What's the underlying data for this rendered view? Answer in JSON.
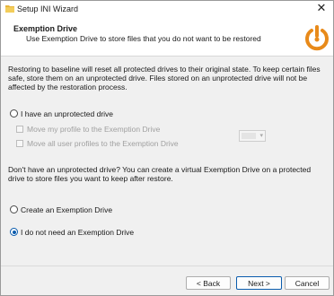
{
  "window": {
    "title": "Setup INI Wizard"
  },
  "header": {
    "title": "Exemption Drive",
    "subtitle": "Use Exemption Drive to store files that you do not want to be restored"
  },
  "intro_text": "Restoring to baseline will reset all protected drives to their original state. To keep certain files safe, store them on an unprotected drive. Files stored on an unprotected drive will not be affected by the restoration process.",
  "options": {
    "have_unprotected": {
      "label": "I have an unprotected drive",
      "selected": false
    },
    "move_my_profile": {
      "label": "Move my profile to the Exemption Drive",
      "checked": false,
      "enabled": false
    },
    "move_all_profiles": {
      "label": "Move all user profiles to the Exemption Drive",
      "checked": false,
      "enabled": false
    },
    "drive_select": {
      "value": "",
      "enabled": false
    },
    "virtual_text": "Don't have an unprotected drive? You can create a virtual Exemption Drive on a protected drive to store files you want to keep after restore.",
    "create_drive": {
      "label": "Create an Exemption Drive",
      "selected": false
    },
    "no_need": {
      "label": "I do not need an Exemption Drive",
      "selected": true
    }
  },
  "footer": {
    "back": "< Back",
    "next": "Next >",
    "cancel": "Cancel"
  },
  "colors": {
    "accent": "#0b5cad",
    "logo": "#e88a1a"
  },
  "icons": {
    "app": "folder-icon",
    "close": "close-icon",
    "logo": "power-restore-logo"
  }
}
